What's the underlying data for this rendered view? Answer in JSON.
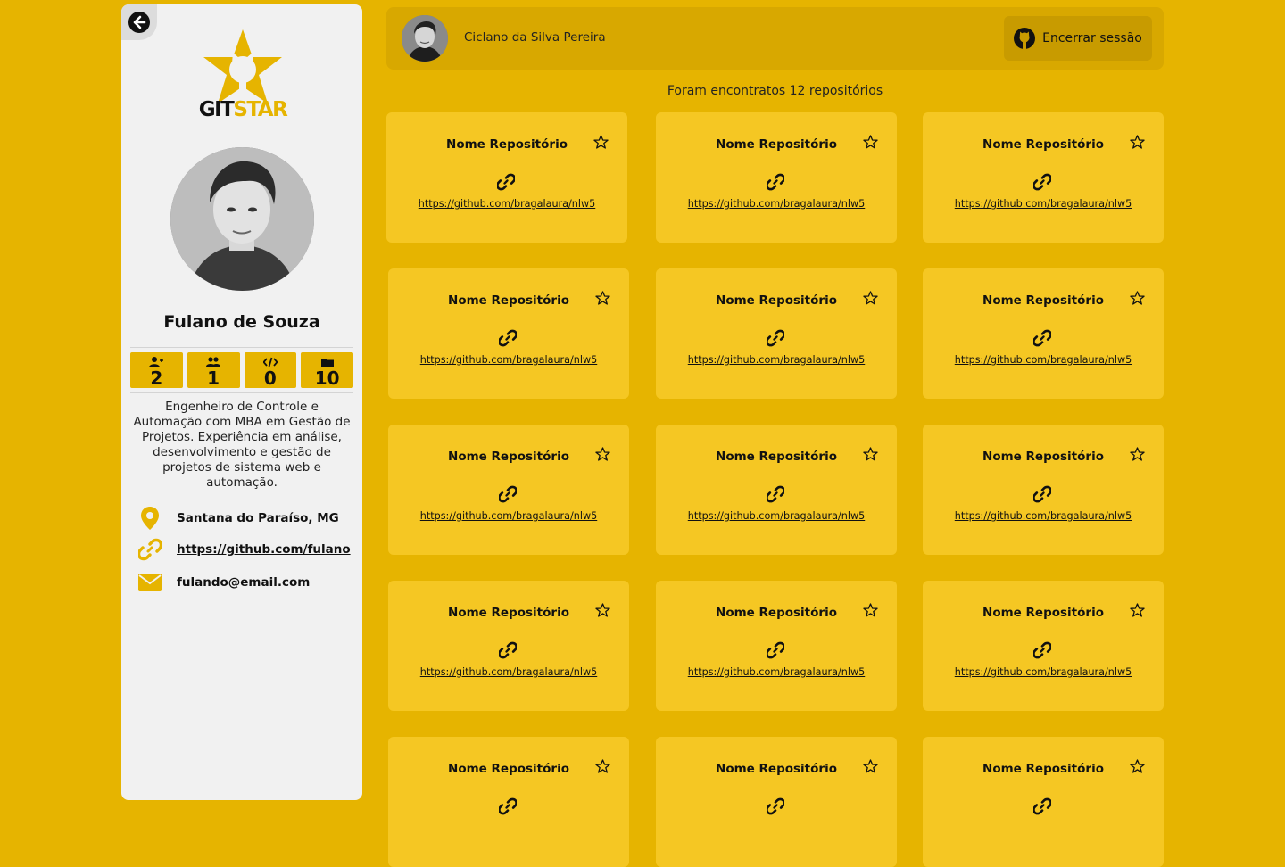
{
  "sidebar": {
    "logo_text_a": "GIT",
    "logo_text_b": "STAR",
    "user_name": "Fulano de Souza",
    "stats": [
      {
        "icon": "user-follow-icon",
        "value": "2"
      },
      {
        "icon": "users-icon",
        "value": "1"
      },
      {
        "icon": "code-icon",
        "value": "0"
      },
      {
        "icon": "folder-icon",
        "value": "10"
      }
    ],
    "bio": "Engenheiro de Controle e Automação com MBA em Gestão de Projetos. Experiência em análise, desenvolvimento e gestão de projetos de sistema web e automação.",
    "location": "Santana do Paraíso, MG",
    "github_link": "https://github.com/fulano",
    "email": "fulando@email.com"
  },
  "header": {
    "user_name": "Ciclano da Silva Pereira",
    "logout_label": "Encerrar sessão"
  },
  "repo_count_text": "Foram encontratos 12 repositórios",
  "repos": [
    {
      "name": "Nome Repositório",
      "url": "https://github.com/bragalaura/nlw5"
    },
    {
      "name": "Nome Repositório",
      "url": "https://github.com/bragalaura/nlw5"
    },
    {
      "name": "Nome Repositório",
      "url": "https://github.com/bragalaura/nlw5"
    },
    {
      "name": "Nome Repositório",
      "url": "https://github.com/bragalaura/nlw5"
    },
    {
      "name": "Nome Repositório",
      "url": "https://github.com/bragalaura/nlw5"
    },
    {
      "name": "Nome Repositório",
      "url": "https://github.com/bragalaura/nlw5"
    },
    {
      "name": "Nome Repositório",
      "url": "https://github.com/bragalaura/nlw5"
    },
    {
      "name": "Nome Repositório",
      "url": "https://github.com/bragalaura/nlw5"
    },
    {
      "name": "Nome Repositório",
      "url": "https://github.com/bragalaura/nlw5"
    },
    {
      "name": "Nome Repositório",
      "url": "https://github.com/bragalaura/nlw5"
    },
    {
      "name": "Nome Repositório",
      "url": "https://github.com/bragalaura/nlw5"
    },
    {
      "name": "Nome Repositório",
      "url": "https://github.com/bragalaura/nlw5"
    },
    {
      "name": "Nome Repositório",
      "url": ""
    },
    {
      "name": "Nome Repositório",
      "url": ""
    },
    {
      "name": "Nome Repositório",
      "url": ""
    }
  ],
  "colors": {
    "background": "#e6b400",
    "card": "#f5c723",
    "sidebar": "#f1f1f1",
    "accent": "#e6b400"
  }
}
